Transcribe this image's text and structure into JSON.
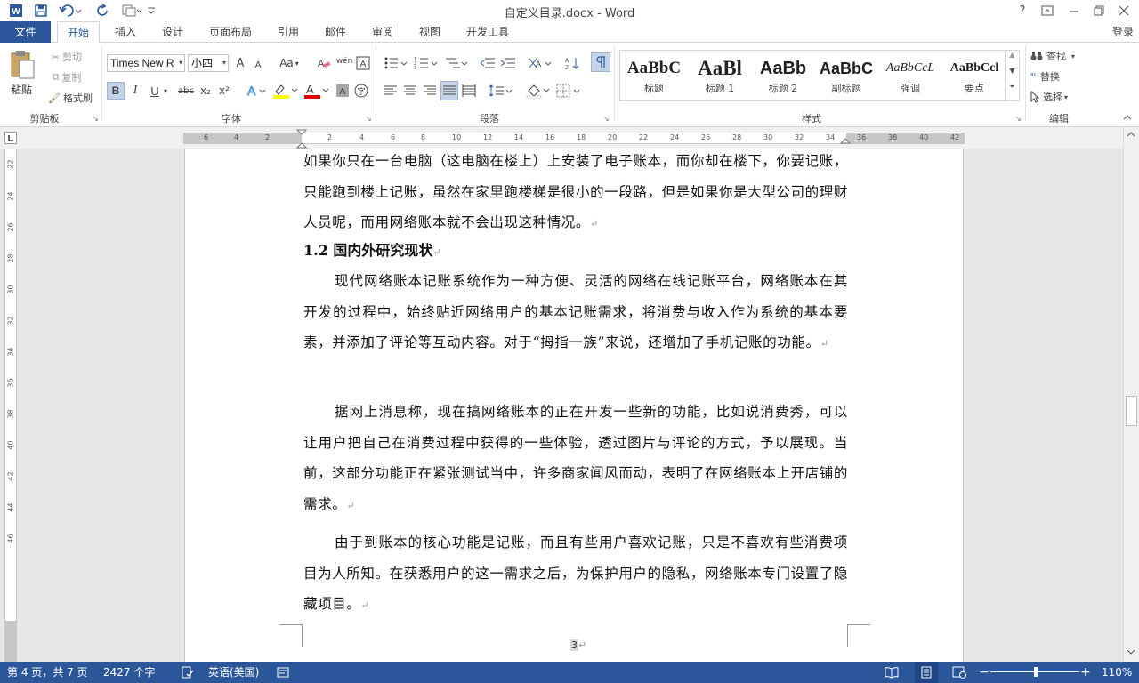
{
  "title": "自定义目录.docx - Word",
  "window": {
    "help": "?",
    "signin": "登录"
  },
  "tabs": [
    {
      "label": "文件"
    },
    {
      "label": "开始"
    },
    {
      "label": "插入"
    },
    {
      "label": "设计"
    },
    {
      "label": "页面布局"
    },
    {
      "label": "引用"
    },
    {
      "label": "邮件"
    },
    {
      "label": "审阅"
    },
    {
      "label": "视图"
    },
    {
      "label": "开发工具"
    }
  ],
  "ribbon": {
    "clipboard": {
      "paste": "粘贴",
      "cut": "剪切",
      "copy": "复制",
      "format_painter": "格式刷",
      "group": "剪贴板"
    },
    "font": {
      "font_name": "Times New R",
      "font_size": "小四",
      "grow": "A",
      "shrink": "A",
      "change_case": "Aa",
      "phonetic": "wén",
      "group": "字体",
      "bold": "B",
      "italic": "I",
      "underline": "U",
      "strike": "abc",
      "sub": "x₂",
      "sup": "x²"
    },
    "paragraph": {
      "group": "段落"
    },
    "styles": {
      "group": "样式",
      "items": [
        {
          "preview": "AaBbC",
          "name": "标题"
        },
        {
          "preview": "AaBl",
          "name": "标题 1"
        },
        {
          "preview": "AaBb",
          "name": "标题 2"
        },
        {
          "preview": "AaBbC",
          "name": "副标题"
        },
        {
          "preview": "AaBbCcL",
          "name": "强调"
        },
        {
          "preview": "AaBbCcl",
          "name": "要点"
        }
      ]
    },
    "editing": {
      "find": "查找",
      "replace": "替换",
      "select": "选择",
      "group": "编辑"
    }
  },
  "ruler": {
    "h_ticks": [
      "6",
      "4",
      "2",
      "2",
      "4",
      "6",
      "8",
      "10",
      "12",
      "14",
      "16",
      "18",
      "20",
      "22",
      "24",
      "26",
      "28",
      "30",
      "32",
      "34",
      "36",
      "38",
      "40",
      "42"
    ],
    "v_ticks": [
      "22",
      "24",
      "26",
      "28",
      "30",
      "32",
      "34",
      "36",
      "38",
      "40",
      "42",
      "44",
      "46"
    ]
  },
  "document": {
    "para0": "如果你只在一台电脑（这电脑在楼上）上安装了电子账本，而你却在楼下，你要记账，只能跑到楼上记账，虽然在家里跑楼梯是很小的一段路，但是如果你是大型公司的理财人员呢，而用网络账本就不会出现这种情况。",
    "heading": "1.2 国内外研究现状",
    "para1": "现代网络账本记账系统作为一种方便、灵活的网络在线记账平台，网络账本在其开发的过程中，始终贴近网络用户的基本记账需求，将消费与收入作为系统的基本要素，并添加了评论等互动内容。对于“拇指一族”来说，还增加了手机记账的功能。",
    "para2": "据网上消息称，现在搞网络账本的正在开发一些新的功能，比如说消费秀，可以让用户把自己在消费过程中获得的一些体验，透过图片与评论的方式，予以展现。当前，这部分功能正在紧张测试当中，许多商家闻风而动，表明了在网络账本上开店铺的需求。",
    "para3": "由于到账本的核心功能是记账，而且有些用户喜欢记账，只是不喜欢有些消费项目为人所知。在获悉用户的这一需求之后，为保护用户的隐私，网络账本专门设置了隐藏项目。",
    "page_number": "3",
    "return_mark": "↵"
  },
  "status": {
    "page": "第 4 页，共 7 页",
    "words": "2427 个字",
    "language": "英语(美国)",
    "zoom": "110%"
  },
  "colors": {
    "accent": "#2b579a"
  }
}
